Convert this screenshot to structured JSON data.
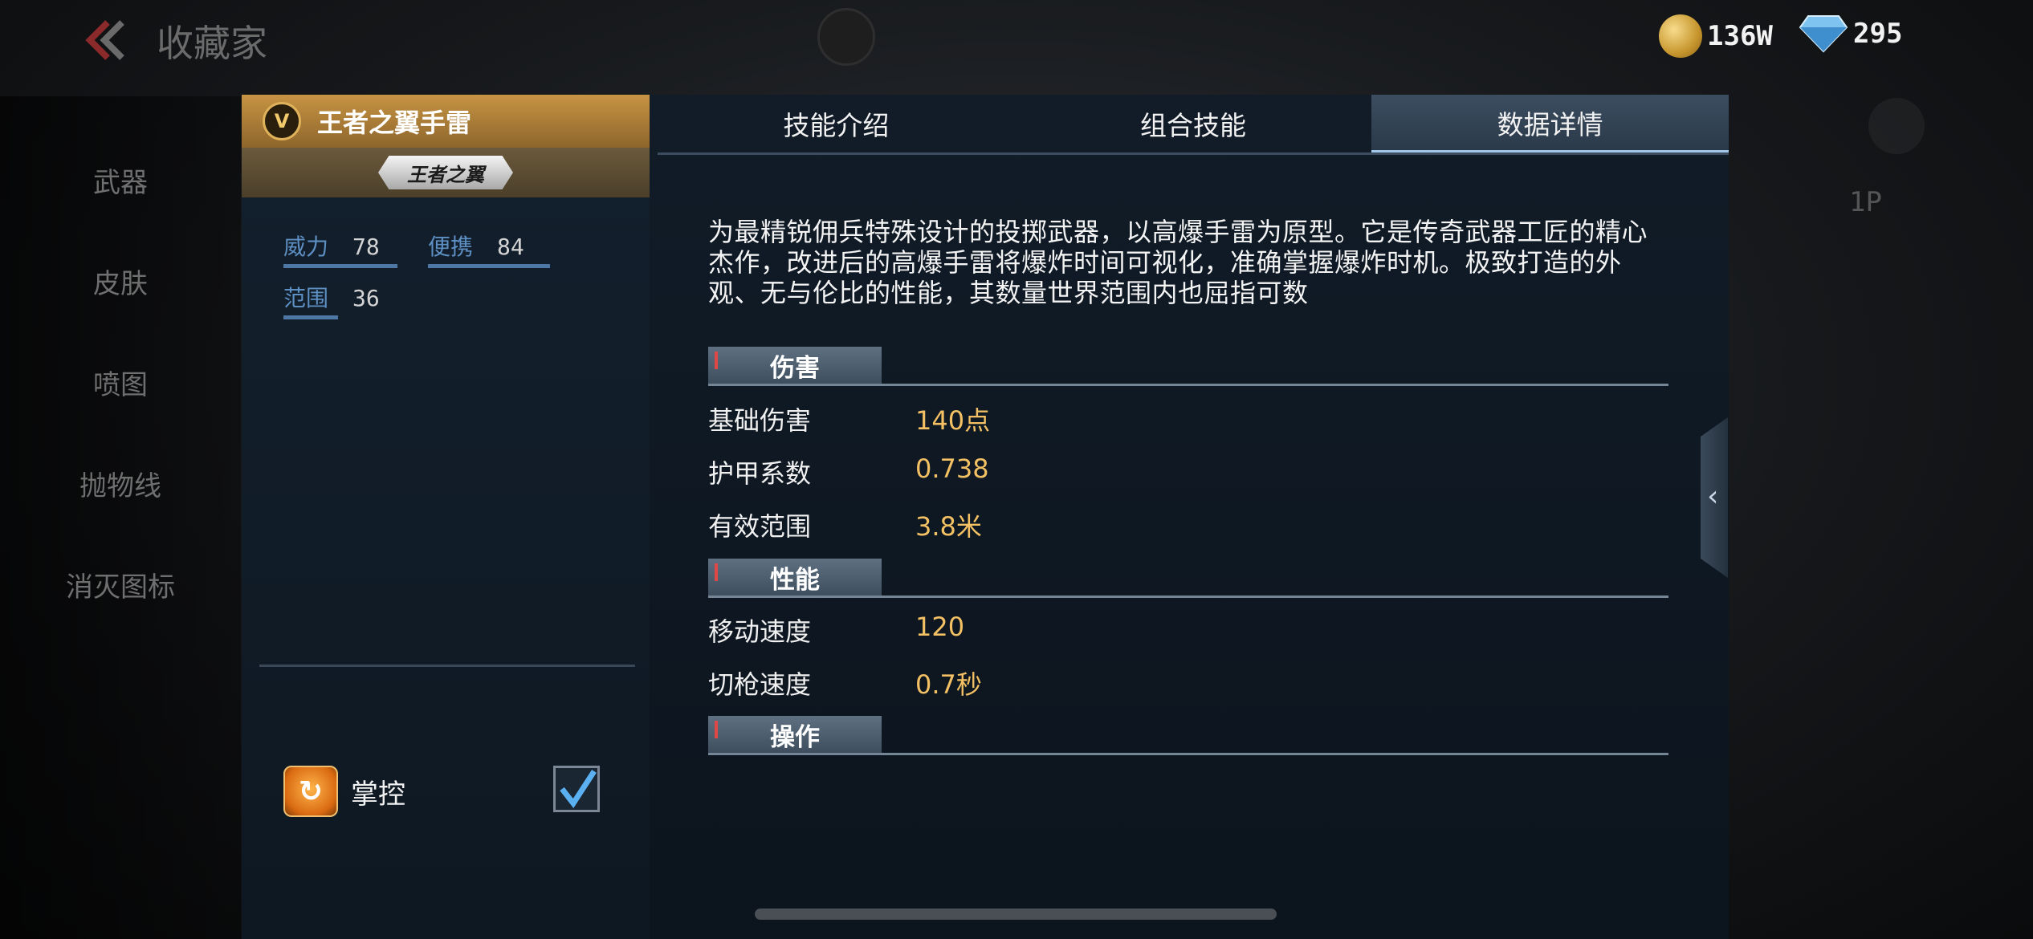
{
  "header": {
    "title": "收藏家",
    "back_label": "back"
  },
  "currency": {
    "gold_value": "136W",
    "diamond_value": "295"
  },
  "background": {
    "categories": [
      "武器",
      "皮肤",
      "喷图",
      "抛物线",
      "消灭图标"
    ],
    "player_label": "1P"
  },
  "weapon": {
    "badge": "V",
    "name": "王者之翼手雷",
    "emblem_text": "王者之翼",
    "stats": [
      {
        "key": "威力",
        "value": "78"
      },
      {
        "key": "便携",
        "value": "84"
      },
      {
        "key": "范围",
        "value": "36"
      }
    ]
  },
  "mastery": {
    "label": "掌控",
    "checked": true
  },
  "tabs": [
    "技能介绍",
    "组合技能",
    "数据详情"
  ],
  "active_tab": "数据详情",
  "description": "为最精锐佣兵特殊设计的投掷武器，以高爆手雷为原型。它是传奇武器工匠的精心杰作，改进后的高爆手雷将爆炸时间可视化，准确掌握爆炸时机。极致打造的外观、无与伦比的性能，其数量世界范围内也屈指可数",
  "sections": [
    {
      "title": "伤害",
      "rows": [
        {
          "label": "基础伤害",
          "value": "140点"
        },
        {
          "label": "护甲系数",
          "value": "0.738"
        },
        {
          "label": "有效范围",
          "value": "3.8米"
        }
      ]
    },
    {
      "title": "性能",
      "rows": [
        {
          "label": "移动速度",
          "value": "120"
        },
        {
          "label": "切枪速度",
          "value": "0.7秒"
        }
      ]
    },
    {
      "title": "操作",
      "rows": []
    }
  ],
  "colors": {
    "accent_gold": "#f3c164",
    "stat_blue": "#5d8fc3",
    "header_gold": "#c69443"
  }
}
